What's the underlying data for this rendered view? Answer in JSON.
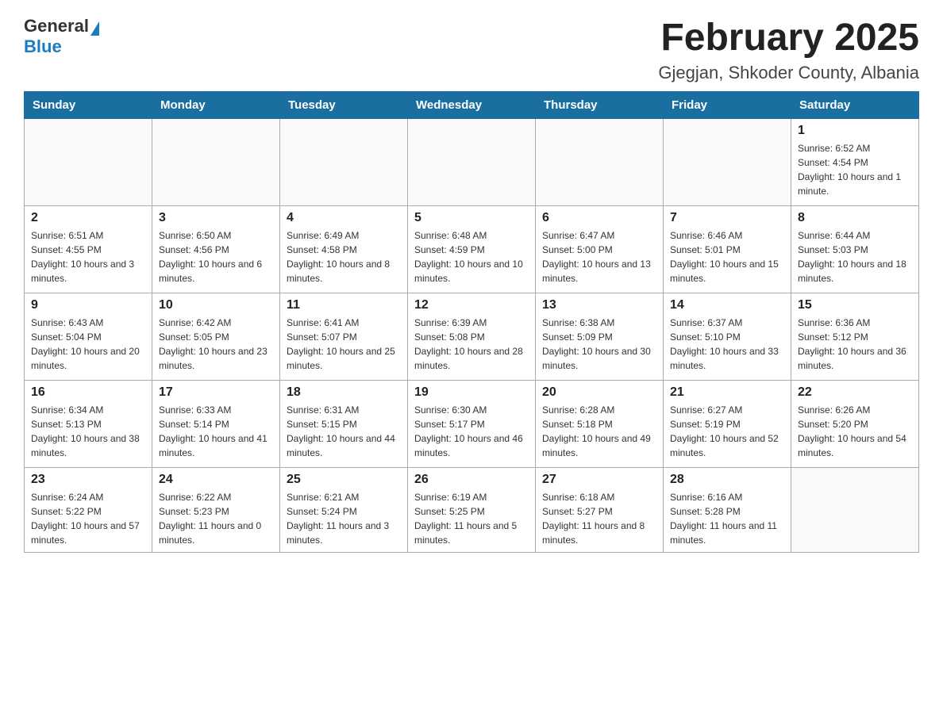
{
  "header": {
    "logo_general": "General",
    "logo_blue": "Blue",
    "title": "February 2025",
    "subtitle": "Gjegjan, Shkoder County, Albania"
  },
  "weekdays": [
    "Sunday",
    "Monday",
    "Tuesday",
    "Wednesday",
    "Thursday",
    "Friday",
    "Saturday"
  ],
  "weeks": [
    [
      {
        "day": "",
        "info": ""
      },
      {
        "day": "",
        "info": ""
      },
      {
        "day": "",
        "info": ""
      },
      {
        "day": "",
        "info": ""
      },
      {
        "day": "",
        "info": ""
      },
      {
        "day": "",
        "info": ""
      },
      {
        "day": "1",
        "info": "Sunrise: 6:52 AM\nSunset: 4:54 PM\nDaylight: 10 hours and 1 minute."
      }
    ],
    [
      {
        "day": "2",
        "info": "Sunrise: 6:51 AM\nSunset: 4:55 PM\nDaylight: 10 hours and 3 minutes."
      },
      {
        "day": "3",
        "info": "Sunrise: 6:50 AM\nSunset: 4:56 PM\nDaylight: 10 hours and 6 minutes."
      },
      {
        "day": "4",
        "info": "Sunrise: 6:49 AM\nSunset: 4:58 PM\nDaylight: 10 hours and 8 minutes."
      },
      {
        "day": "5",
        "info": "Sunrise: 6:48 AM\nSunset: 4:59 PM\nDaylight: 10 hours and 10 minutes."
      },
      {
        "day": "6",
        "info": "Sunrise: 6:47 AM\nSunset: 5:00 PM\nDaylight: 10 hours and 13 minutes."
      },
      {
        "day": "7",
        "info": "Sunrise: 6:46 AM\nSunset: 5:01 PM\nDaylight: 10 hours and 15 minutes."
      },
      {
        "day": "8",
        "info": "Sunrise: 6:44 AM\nSunset: 5:03 PM\nDaylight: 10 hours and 18 minutes."
      }
    ],
    [
      {
        "day": "9",
        "info": "Sunrise: 6:43 AM\nSunset: 5:04 PM\nDaylight: 10 hours and 20 minutes."
      },
      {
        "day": "10",
        "info": "Sunrise: 6:42 AM\nSunset: 5:05 PM\nDaylight: 10 hours and 23 minutes."
      },
      {
        "day": "11",
        "info": "Sunrise: 6:41 AM\nSunset: 5:07 PM\nDaylight: 10 hours and 25 minutes."
      },
      {
        "day": "12",
        "info": "Sunrise: 6:39 AM\nSunset: 5:08 PM\nDaylight: 10 hours and 28 minutes."
      },
      {
        "day": "13",
        "info": "Sunrise: 6:38 AM\nSunset: 5:09 PM\nDaylight: 10 hours and 30 minutes."
      },
      {
        "day": "14",
        "info": "Sunrise: 6:37 AM\nSunset: 5:10 PM\nDaylight: 10 hours and 33 minutes."
      },
      {
        "day": "15",
        "info": "Sunrise: 6:36 AM\nSunset: 5:12 PM\nDaylight: 10 hours and 36 minutes."
      }
    ],
    [
      {
        "day": "16",
        "info": "Sunrise: 6:34 AM\nSunset: 5:13 PM\nDaylight: 10 hours and 38 minutes."
      },
      {
        "day": "17",
        "info": "Sunrise: 6:33 AM\nSunset: 5:14 PM\nDaylight: 10 hours and 41 minutes."
      },
      {
        "day": "18",
        "info": "Sunrise: 6:31 AM\nSunset: 5:15 PM\nDaylight: 10 hours and 44 minutes."
      },
      {
        "day": "19",
        "info": "Sunrise: 6:30 AM\nSunset: 5:17 PM\nDaylight: 10 hours and 46 minutes."
      },
      {
        "day": "20",
        "info": "Sunrise: 6:28 AM\nSunset: 5:18 PM\nDaylight: 10 hours and 49 minutes."
      },
      {
        "day": "21",
        "info": "Sunrise: 6:27 AM\nSunset: 5:19 PM\nDaylight: 10 hours and 52 minutes."
      },
      {
        "day": "22",
        "info": "Sunrise: 6:26 AM\nSunset: 5:20 PM\nDaylight: 10 hours and 54 minutes."
      }
    ],
    [
      {
        "day": "23",
        "info": "Sunrise: 6:24 AM\nSunset: 5:22 PM\nDaylight: 10 hours and 57 minutes."
      },
      {
        "day": "24",
        "info": "Sunrise: 6:22 AM\nSunset: 5:23 PM\nDaylight: 11 hours and 0 minutes."
      },
      {
        "day": "25",
        "info": "Sunrise: 6:21 AM\nSunset: 5:24 PM\nDaylight: 11 hours and 3 minutes."
      },
      {
        "day": "26",
        "info": "Sunrise: 6:19 AM\nSunset: 5:25 PM\nDaylight: 11 hours and 5 minutes."
      },
      {
        "day": "27",
        "info": "Sunrise: 6:18 AM\nSunset: 5:27 PM\nDaylight: 11 hours and 8 minutes."
      },
      {
        "day": "28",
        "info": "Sunrise: 6:16 AM\nSunset: 5:28 PM\nDaylight: 11 hours and 11 minutes."
      },
      {
        "day": "",
        "info": ""
      }
    ]
  ]
}
